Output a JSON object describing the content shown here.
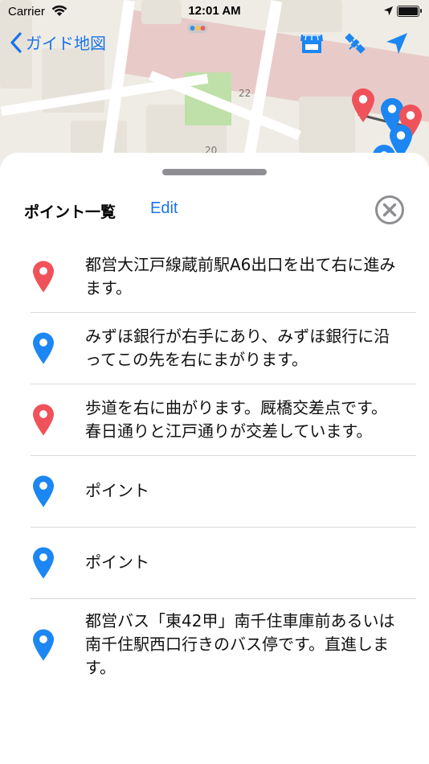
{
  "status_bar": {
    "carrier": "Carrier",
    "time": "12:01 AM"
  },
  "nav": {
    "back_label": "ガイド地図"
  },
  "map": {
    "labels": [
      "22",
      "20"
    ]
  },
  "sheet": {
    "title": "ポイント一覧",
    "edit_label": "Edit"
  },
  "points": [
    {
      "text": "都営大江戸線蔵前駅A6出口を出て右に進みます。",
      "color": "red"
    },
    {
      "text": "みずほ銀行が右手にあり、みずほ銀行に沿ってこの先を右にまがります。",
      "color": "blue"
    },
    {
      "text": "歩道を右に曲がります。厩橋交差点です。春日通りと江戸通りが交差しています。",
      "color": "red"
    },
    {
      "text": "ポイント",
      "color": "blue"
    },
    {
      "text": "ポイント",
      "color": "blue"
    },
    {
      "text": "都営バス「東42甲」南千住車庫前あるいは南千住駅西口行きのバス停です。直進します。",
      "color": "blue"
    }
  ],
  "colors": {
    "accent": "#1a73e8",
    "pin_red": "#f0525a",
    "pin_blue": "#1c86f2"
  }
}
